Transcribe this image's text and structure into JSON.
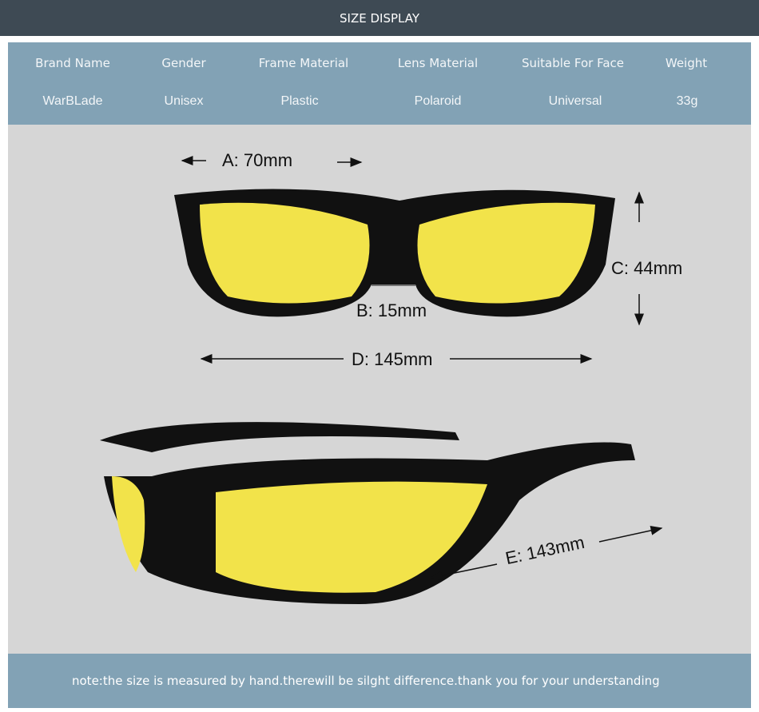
{
  "header": {
    "title": "SIZE DISPLAY"
  },
  "specs": {
    "headers": [
      "Brand Name",
      "Gender",
      "Frame Material",
      "Lens Material",
      "Suitable For Face",
      "Weight"
    ],
    "values": [
      "WarBLade",
      "Unisex",
      "Plastic",
      "Polaroid",
      "Universal",
      "33g"
    ]
  },
  "dimensions": {
    "a": "A: 70mm",
    "b": "B: 15mm",
    "c": "C: 44mm",
    "d": "D: 145mm",
    "e": "E: 143mm"
  },
  "colors": {
    "header": "#3e4a54",
    "panel": "#82a2b5",
    "stage": "#d6d6d6",
    "lens": "#f2e34a"
  },
  "footer": {
    "note": "note:the size is measured by hand.therewill be silght difference.thank you for your understanding"
  }
}
